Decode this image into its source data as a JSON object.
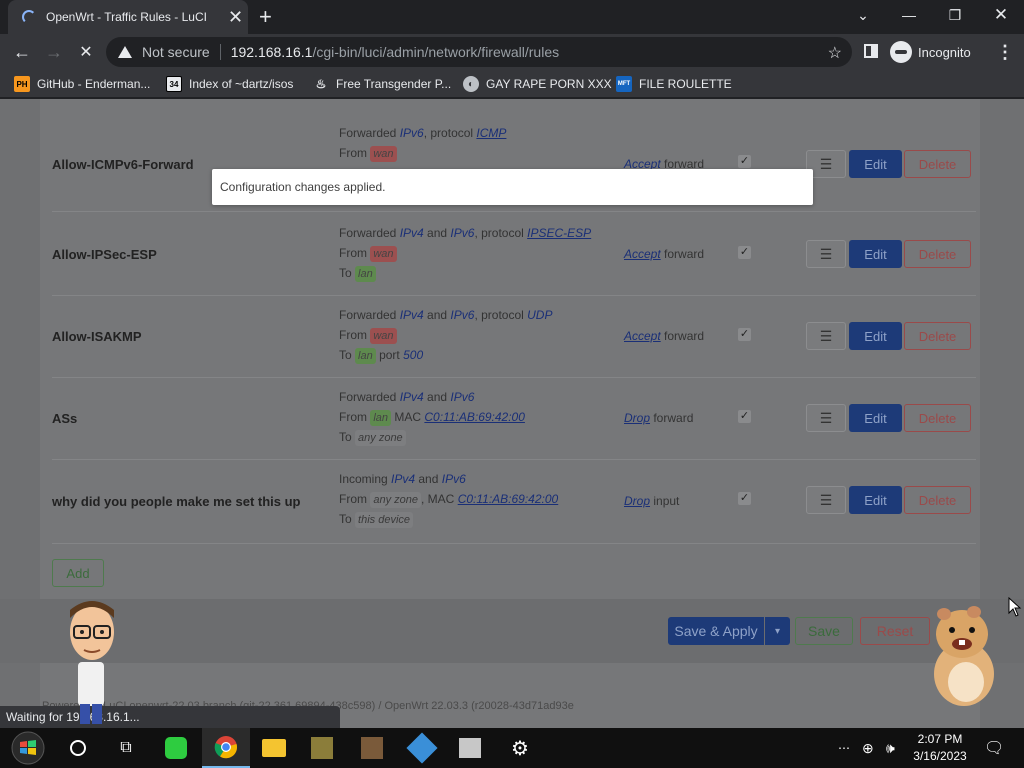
{
  "browser": {
    "tab_title": "OpenWrt - Traffic Rules - LuCI",
    "security_label": "Not secure",
    "url_host": "192.168.16.1",
    "url_path": "/cgi-bin/luci/admin/network/firewall/rules",
    "profile_label": "Incognito",
    "bookmarks": [
      {
        "icon": "PH",
        "label": "GitHub - Enderman..."
      },
      {
        "icon": "34",
        "label": "Index of ~dartz/isos"
      },
      {
        "icon": "",
        "label": "Free Transgender P..."
      },
      {
        "icon": "",
        "label": "GAY RAPE PORN XXX"
      },
      {
        "icon": "MFT",
        "label": "FILE ROULETTE"
      }
    ],
    "status_text": "Waiting for 19...68.16.1..."
  },
  "toast": {
    "message": "Configuration changes applied."
  },
  "rules": [
    {
      "name": "Allow-ICMPv6-Forward",
      "line1": {
        "pre": "Forwarded ",
        "p1": "IPv6",
        "mid": ", protocol ",
        "proto": "ICMP"
      },
      "from_label": "From",
      "from_zone": "wan",
      "action_word": "Accept",
      "action_rest": " forward"
    },
    {
      "name": "Allow-IPSec-ESP",
      "line1": {
        "pre": "Forwarded ",
        "p1": "IPv4",
        "and": " and ",
        "p2": "IPv6",
        "mid": ", protocol ",
        "proto": "IPSEC-ESP"
      },
      "from_label": "From",
      "from_zone": "wan",
      "to_label": "To",
      "to_zone": "lan",
      "action_word": "Accept",
      "action_rest": " forward"
    },
    {
      "name": "Allow-ISAKMP",
      "line1": {
        "pre": "Forwarded ",
        "p1": "IPv4",
        "and": " and ",
        "p2": "IPv6",
        "mid": ", protocol ",
        "proto": "UDP"
      },
      "from_label": "From",
      "from_zone": "wan",
      "to_label": "To",
      "to_zone": "lan",
      "port_label": "port",
      "port": "500",
      "action_word": "Accept",
      "action_rest": " forward"
    },
    {
      "name": "ASs",
      "line1": {
        "pre": "Forwarded ",
        "p1": "IPv4",
        "and": " and ",
        "p2": "IPv6"
      },
      "from_label": "From",
      "from_zone": "lan",
      "mac_label": "MAC",
      "mac": "C0:11:AB:69:42:00",
      "to_label": "To",
      "to_zone": "any zone",
      "action_word": "Drop",
      "action_rest": " forward"
    },
    {
      "name": "why did you people make me set this up",
      "line1": {
        "pre": "Incoming ",
        "p1": "IPv4",
        "and": " and ",
        "p2": "IPv6"
      },
      "from_label": "From",
      "from_zone": "any zone",
      "mac_label": "MAC",
      "mac": "C0:11:AB:69:42:00",
      "to_label": "To",
      "to_zone": "this device",
      "action_word": "Drop",
      "action_rest": " input"
    }
  ],
  "row_buttons": {
    "drag": "☰",
    "edit": "Edit",
    "delete": "Delete"
  },
  "actions": {
    "add": "Add",
    "save_apply": "Save & Apply",
    "save": "Save",
    "reset": "Reset"
  },
  "footer": "Powered by LuCI openwrt-22.03 branch (git-22.361.69894-438c598) / OpenWrt 22.03.3 (r20028-43d71ad93e",
  "taskbar": {
    "time": "2:07 PM",
    "date": "3/16/2023"
  },
  "colors": {
    "accent_blue": "#1d3a78",
    "danger": "#9a4a4a",
    "success": "#4f7a4e",
    "wan": "#9c5050",
    "lan": "#5e8a4e"
  }
}
